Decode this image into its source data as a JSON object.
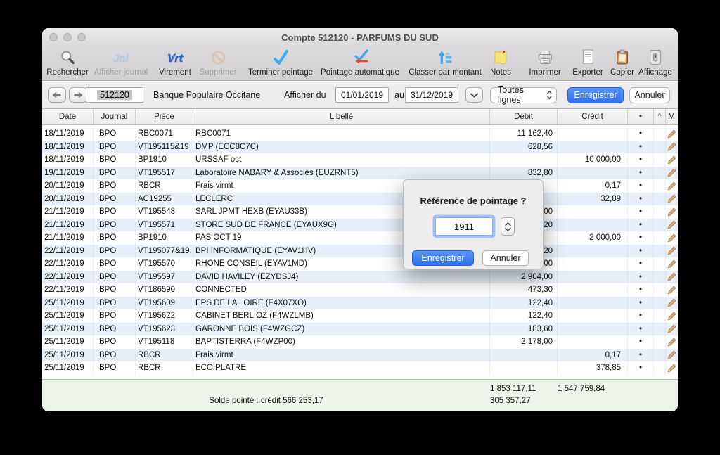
{
  "window": {
    "title": "Compte 512120 - PARFUMS DU SUD"
  },
  "toolbar": {
    "items": [
      {
        "label": "Rechercher"
      },
      {
        "label": "Afficher journal"
      },
      {
        "label": "Virement"
      },
      {
        "label": "Supprimer"
      },
      {
        "label": "Terminer pointage"
      },
      {
        "label": "Pointage automatique"
      },
      {
        "label": "Classer par montant"
      },
      {
        "label": "Notes"
      },
      {
        "label": "Imprimer"
      },
      {
        "label": "Exporter"
      },
      {
        "label": "Copier"
      },
      {
        "label": "Affichage"
      }
    ]
  },
  "filter_bar": {
    "account_number": "512120",
    "account_name": "Banque Populaire Occitane",
    "show_from_label": "Afficher du",
    "date_from": "01/01/2019",
    "to_label": "au",
    "date_to": "31/12/2019",
    "lines_filter": "Toutes lignes",
    "save_label": "Enregistrer",
    "cancel_label": "Annuler"
  },
  "table": {
    "columns": {
      "date": "Date",
      "journal": "Journal",
      "piece": "Pièce",
      "libelle": "Libellé",
      "debit": "Débit",
      "credit": "Crédit",
      "dot": "•",
      "caret": "^",
      "m": "M"
    },
    "rows": [
      {
        "date": "18/11/2019",
        "journal": "BPO",
        "piece": "RBC0071",
        "libelle": "RBC0071",
        "debit": "11 162,40",
        "credit": "",
        "dot": "•"
      },
      {
        "date": "18/11/2019",
        "journal": "BPO",
        "piece": "VT195115&19",
        "libelle": "DMP (ECC8C7C)",
        "debit": "628,56",
        "credit": "",
        "dot": "•"
      },
      {
        "date": "18/11/2019",
        "journal": "BPO",
        "piece": "BP1910",
        "libelle": "URSSAF oct",
        "debit": "",
        "credit": "10 000,00",
        "dot": "•"
      },
      {
        "date": "19/11/2019",
        "journal": "BPO",
        "piece": "VT195517",
        "libelle": "Laboratoire NABARY & Associés (EUZRNT5)",
        "debit": "832,80",
        "credit": "",
        "dot": "•"
      },
      {
        "date": "20/11/2019",
        "journal": "BPO",
        "piece": "RBCR",
        "libelle": "Frais virmt",
        "debit": "",
        "credit": "0,17",
        "dot": "•"
      },
      {
        "date": "20/11/2019",
        "journal": "BPO",
        "piece": "AC19255",
        "libelle": "LECLERC",
        "debit": "",
        "credit": "32,89",
        "dot": "•"
      },
      {
        "date": "21/11/2019",
        "journal": "BPO",
        "piece": "VT195548",
        "libelle": "SARL JPMT HEXB (EYAU33B)",
        "debit": "00",
        "credit": "",
        "dot": "•"
      },
      {
        "date": "21/11/2019",
        "journal": "BPO",
        "piece": "VT195571",
        "libelle": "STORE SUD DE FRANCE (EYAUX9G)",
        "debit": "20",
        "credit": "",
        "dot": "•"
      },
      {
        "date": "21/11/2019",
        "journal": "BPO",
        "piece": "BP1910",
        "libelle": "PAS OCT 19",
        "debit": "",
        "credit": "2 000,00",
        "dot": "•"
      },
      {
        "date": "22/11/2019",
        "journal": "BPO",
        "piece": "VT195077&19",
        "libelle": "BPI INFORMATIQUE (EYAV1HV)",
        "debit": "20",
        "credit": "",
        "dot": "•"
      },
      {
        "date": "22/11/2019",
        "journal": "BPO",
        "piece": "VT195570",
        "libelle": "RHONE CONSEIL (EYAV1MD)",
        "debit": "00",
        "credit": "",
        "dot": "•"
      },
      {
        "date": "22/11/2019",
        "journal": "BPO",
        "piece": "VT195597",
        "libelle": "DAVID HAVILEY (EZYDSJ4)",
        "debit": "2 904,00",
        "credit": "",
        "dot": "•"
      },
      {
        "date": "22/11/2019",
        "journal": "BPO",
        "piece": "VT186590",
        "libelle": "CONNECTED",
        "debit": "473,30",
        "credit": "",
        "dot": "•"
      },
      {
        "date": "25/11/2019",
        "journal": "BPO",
        "piece": "VT195609",
        "libelle": "EPS DE LA LOIRE (F4X07XO)",
        "debit": "122,40",
        "credit": "",
        "dot": "•"
      },
      {
        "date": "25/11/2019",
        "journal": "BPO",
        "piece": "VT195622",
        "libelle": "CABINET BERLIOZ (F4WZLMB)",
        "debit": "122,40",
        "credit": "",
        "dot": "•"
      },
      {
        "date": "25/11/2019",
        "journal": "BPO",
        "piece": "VT195623",
        "libelle": "GARONNE BOIS (F4WZGCZ)",
        "debit": "183,60",
        "credit": "",
        "dot": "•"
      },
      {
        "date": "25/11/2019",
        "journal": "BPO",
        "piece": "VT195118",
        "libelle": "BAPTISTERRA (F4WZP00)",
        "debit": "2 178,00",
        "credit": "",
        "dot": "•"
      },
      {
        "date": "25/11/2019",
        "journal": "BPO",
        "piece": "RBCR",
        "libelle": "Frais virmt",
        "debit": "",
        "credit": "0,17",
        "dot": "•"
      },
      {
        "date": "25/11/2019",
        "journal": "BPO",
        "piece": "RBCR",
        "libelle": "ECO PLATRE",
        "debit": "",
        "credit": "378,85",
        "dot": "•"
      }
    ],
    "totals": {
      "debit": "1 853 117,11",
      "credit": "1 547 759,84"
    },
    "balance_label": "Solde pointé : crédit 566 253,17",
    "balance_debit": "305 357,27"
  },
  "dialog": {
    "title": "Référence de pointage ?",
    "input_value": "1911",
    "save_label": "Enregistrer",
    "cancel_label": "Annuler"
  },
  "colors": {
    "accent_blue": "#306fef",
    "row_alt_blue": "#e7f0fa",
    "footer_green": "#edf5ea",
    "icon_blue": "#3fa9f5",
    "icon_red": "#e14b2a",
    "note_yellow": "#f9e276",
    "clipboard_brown": "#b07a4e",
    "pencil_tan": "#e0a96d"
  }
}
